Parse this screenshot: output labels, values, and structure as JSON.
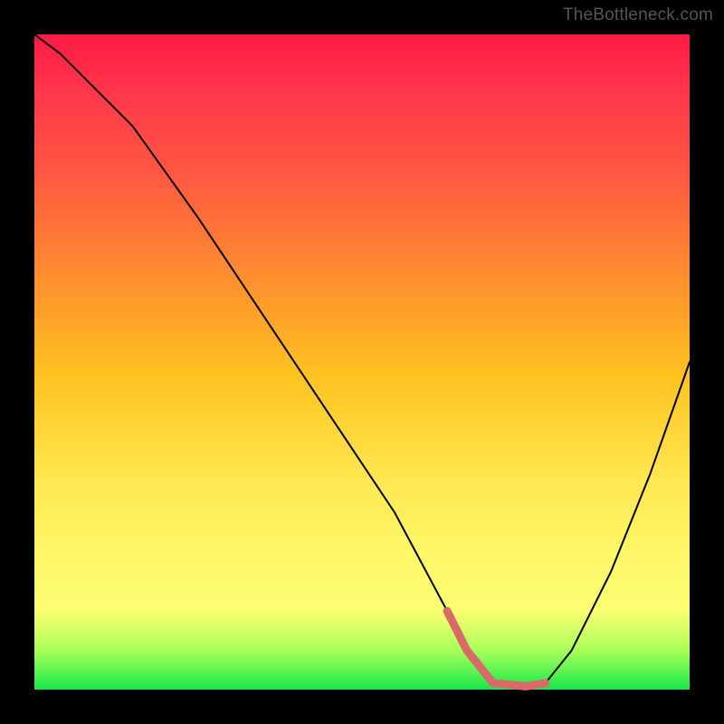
{
  "watermark": "TheBottleneck.com",
  "chart_data": {
    "type": "line",
    "title": "",
    "xlabel": "",
    "ylabel": "",
    "xlim": [
      0,
      100
    ],
    "ylim": [
      0,
      100
    ],
    "series": [
      {
        "name": "curve",
        "x": [
          0,
          4,
          8,
          15,
          25,
          35,
          45,
          55,
          63,
          66,
          70,
          75,
          78,
          82,
          88,
          94,
          100
        ],
        "values": [
          100,
          97,
          93,
          86,
          72,
          57,
          42,
          27,
          12,
          6,
          1,
          0.5,
          1,
          6,
          18,
          33,
          50
        ]
      }
    ],
    "highlight_segment": {
      "x": [
        63,
        66,
        70,
        75,
        78
      ],
      "values": [
        12,
        6,
        1,
        0.5,
        1
      ],
      "color": "#d96a6a"
    }
  }
}
